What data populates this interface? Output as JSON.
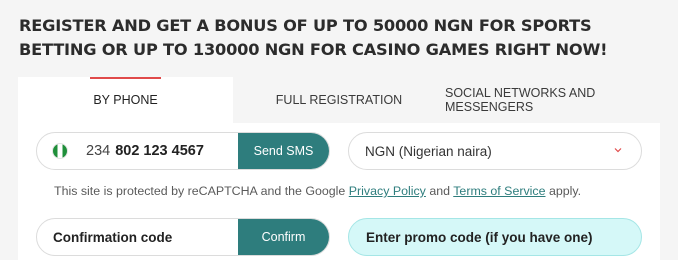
{
  "headline": "REGISTER AND GET A BONUS OF UP TO 50000 NGN FOR SPORTS BETTING OR UP TO 130000 NGN FOR CASINO GAMES RIGHT NOW!",
  "tabs": [
    {
      "label": "BY PHONE",
      "active": true
    },
    {
      "label": "FULL REGISTRATION",
      "active": false
    },
    {
      "label": "SOCIAL NETWORKS AND MESSENGERS",
      "active": false
    }
  ],
  "phone": {
    "country": "Nigeria",
    "code": "234",
    "number": "802 123 4567",
    "send_sms_label": "Send SMS"
  },
  "currency": {
    "selected": "NGN (Nigerian naira)",
    "icon": "chevron-down-icon"
  },
  "captcha": {
    "prefix": "This site is protected by reCAPTCHA and the Google ",
    "privacy_link": "Privacy Policy",
    "middle": " and ",
    "terms_link": "Terms of Service",
    "suffix": " apply."
  },
  "confirmation": {
    "placeholder": "Confirmation code",
    "confirm_label": "Confirm"
  },
  "promo": {
    "label": "Enter promo code (if you have one)"
  },
  "colors": {
    "accent_teal": "#2e7d7d",
    "tab_indicator": "#e04a4a",
    "promo_bg": "#d5f8f8"
  }
}
